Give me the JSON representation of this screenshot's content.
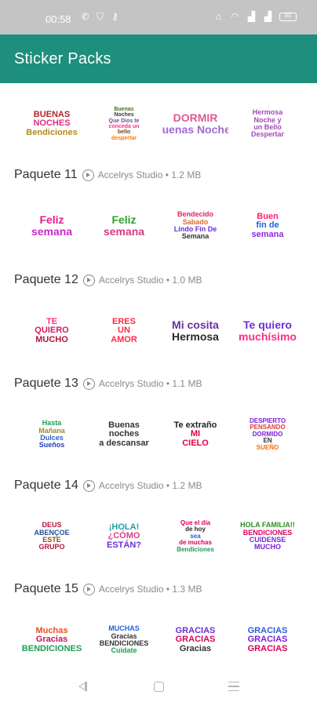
{
  "status_bar": {
    "time": "00:58",
    "left_icons": [
      "whatsapp-icon",
      "shield-icon",
      "key-icon"
    ],
    "right_icons": [
      "hotspot-icon",
      "wifi-icon",
      "signal-icon",
      "signal-icon-2"
    ],
    "battery": "60"
  },
  "app_bar": {
    "title": "Sticker Packs",
    "color": "#1d8f7c"
  },
  "packs": [
    {
      "name": "",
      "publisher": "",
      "size": "",
      "stickers": [
        {
          "lines": [
            "BUENAS",
            "NOCHES",
            "Bendiciones"
          ]
        },
        {
          "lines": [
            "Buenas",
            "Noches",
            "Que Dios te",
            "conceda un",
            "bello",
            "despertar"
          ]
        },
        {
          "lines": [
            "DORMIR",
            "Buenas Noches"
          ]
        },
        {
          "lines": [
            "Hermosa",
            "Noche y",
            "un Bello",
            "Despertar"
          ]
        }
      ]
    },
    {
      "name": "Paquete 11",
      "publisher": "Accelrys Studio",
      "size": "1.2 MB",
      "stickers": [
        {
          "lines": [
            "Feliz",
            "semana"
          ]
        },
        {
          "lines": [
            "Feliz",
            "semana"
          ]
        },
        {
          "lines": [
            "Bendecido",
            "Sabado",
            "Lindo Fin De",
            "Semana"
          ]
        },
        {
          "lines": [
            "Buen",
            "fin de",
            "semana"
          ]
        }
      ]
    },
    {
      "name": "Paquete 12",
      "publisher": "Accelrys Studio",
      "size": "1.0 MB",
      "stickers": [
        {
          "lines": [
            "TE",
            "QUIERO",
            "MUCHO"
          ]
        },
        {
          "lines": [
            "ERES",
            "UN",
            "AMOR"
          ]
        },
        {
          "lines": [
            "Mi cosita",
            "Hermosa"
          ]
        },
        {
          "lines": [
            "Te quiero",
            "muchísimo"
          ]
        }
      ]
    },
    {
      "name": "Paquete 13",
      "publisher": "Accelrys Studio",
      "size": "1.1 MB",
      "stickers": [
        {
          "lines": [
            "Hasta",
            "Mañana",
            "Dulces",
            "Sueños"
          ]
        },
        {
          "lines": [
            "Buenas",
            "noches",
            "a descansar"
          ]
        },
        {
          "lines": [
            "Te extraño",
            "MI",
            "CIELO"
          ]
        },
        {
          "lines": [
            "DESPIERTO",
            "PENSANDO",
            "DORMIDO",
            "EN",
            "SUEÑO"
          ]
        }
      ]
    },
    {
      "name": "Paquete 14",
      "publisher": "Accelrys Studio",
      "size": "1.2 MB",
      "stickers": [
        {
          "lines": [
            "DEUS",
            "ABENÇOE",
            "ESTE",
            "GRUPO"
          ]
        },
        {
          "lines": [
            "¡HOLA!",
            "¿CÓMO",
            "ESTÁN?"
          ]
        },
        {
          "lines": [
            "Que el día",
            "de hoy",
            "sea",
            "de muchas",
            "Bendiciones"
          ]
        },
        {
          "lines": [
            "HOLA FAMILIA!!",
            "BENDICIONES",
            "CUIDENSE",
            "MUCHO"
          ]
        }
      ]
    },
    {
      "name": "Paquete 15",
      "publisher": "Accelrys Studio",
      "size": "1.3 MB",
      "stickers": [
        {
          "lines": [
            "Muchas",
            "Gracias",
            "BENDICIONES"
          ]
        },
        {
          "lines": [
            "MUCHAS",
            "Gracias",
            "BENDICIONES",
            "Cuidate"
          ]
        },
        {
          "lines": [
            "GRACIAS",
            "GRACIAS",
            "Gracias"
          ]
        },
        {
          "lines": [
            "GRACIAS",
            "GRACIAS",
            "GRACIAS"
          ]
        }
      ]
    }
  ]
}
